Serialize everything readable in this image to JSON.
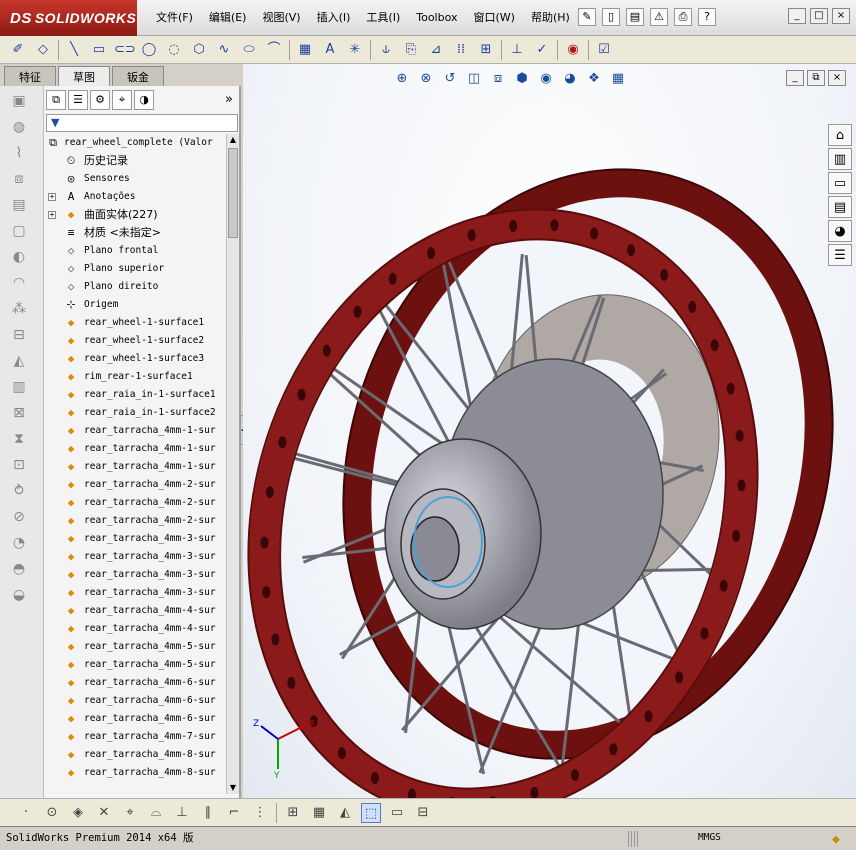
{
  "app": {
    "logo": "SOLIDWORKS",
    "logo_mark": "DS"
  },
  "menu": [
    "文件(F)",
    "编辑(E)",
    "视图(V)",
    "插入(I)",
    "工具(I)",
    "Toolbox",
    "窗口(W)",
    "帮助(H)"
  ],
  "window_controls": [
    "_",
    "□",
    "×"
  ],
  "left_tabs": [
    "特征",
    "草图",
    "钣金"
  ],
  "left_tab_active": 1,
  "tree": [
    {
      "label": "rear_wheel_complete  (Valor",
      "icon": "part-icon",
      "type": "root"
    },
    {
      "label": "历史记录",
      "icon": "history-icon",
      "cjk": true
    },
    {
      "label": "Sensores",
      "icon": "sensor-icon"
    },
    {
      "label": "Anotações",
      "icon": "annotation-icon",
      "expand": true
    },
    {
      "label": "曲面实体(227)",
      "icon": "surface-bodies-icon",
      "expand": true,
      "cjk": true
    },
    {
      "label": "材质 <未指定>",
      "icon": "material-icon",
      "cjk": true
    },
    {
      "label": "Plano frontal",
      "icon": "plane-icon"
    },
    {
      "label": "Plano superior",
      "icon": "plane-icon"
    },
    {
      "label": "Plano direito",
      "icon": "plane-icon"
    },
    {
      "label": "Origem",
      "icon": "origin-icon"
    },
    {
      "label": "rear_wheel-1-surface1",
      "icon": "surface-icon"
    },
    {
      "label": "rear_wheel-1-surface2",
      "icon": "surface-icon"
    },
    {
      "label": "rear_wheel-1-surface3",
      "icon": "surface-icon"
    },
    {
      "label": "rim_rear-1-surface1",
      "icon": "surface-icon"
    },
    {
      "label": "rear_raia_in-1-surface1",
      "icon": "surface-icon"
    },
    {
      "label": "rear_raia_in-1-surface2",
      "icon": "surface-icon"
    },
    {
      "label": "rear_tarracha_4mm-1-sur",
      "icon": "surface-icon"
    },
    {
      "label": "rear_tarracha_4mm-1-sur",
      "icon": "surface-icon"
    },
    {
      "label": "rear_tarracha_4mm-1-sur",
      "icon": "surface-icon"
    },
    {
      "label": "rear_tarracha_4mm-2-sur",
      "icon": "surface-icon"
    },
    {
      "label": "rear_tarracha_4mm-2-sur",
      "icon": "surface-icon"
    },
    {
      "label": "rear_tarracha_4mm-2-sur",
      "icon": "surface-icon"
    },
    {
      "label": "rear_tarracha_4mm-3-sur",
      "icon": "surface-icon"
    },
    {
      "label": "rear_tarracha_4mm-3-sur",
      "icon": "surface-icon"
    },
    {
      "label": "rear_tarracha_4mm-3-sur",
      "icon": "surface-icon"
    },
    {
      "label": "rear_tarracha_4mm-3-sur",
      "icon": "surface-icon"
    },
    {
      "label": "rear_tarracha_4mm-4-sur",
      "icon": "surface-icon"
    },
    {
      "label": "rear_tarracha_4mm-4-sur",
      "icon": "surface-icon"
    },
    {
      "label": "rear_tarracha_4mm-5-sur",
      "icon": "surface-icon"
    },
    {
      "label": "rear_tarracha_4mm-5-sur",
      "icon": "surface-icon"
    },
    {
      "label": "rear_tarracha_4mm-6-sur",
      "icon": "surface-icon"
    },
    {
      "label": "rear_tarracha_4mm-6-sur",
      "icon": "surface-icon"
    },
    {
      "label": "rear_tarracha_4mm-6-sur",
      "icon": "surface-icon"
    },
    {
      "label": "rear_tarracha_4mm-7-sur",
      "icon": "surface-icon"
    },
    {
      "label": "rear_tarracha_4mm-8-sur",
      "icon": "surface-icon"
    },
    {
      "label": "rear_tarracha_4mm-8-sur",
      "icon": "surface-icon"
    }
  ],
  "triad": {
    "x": "X",
    "y": "Y",
    "z": "Z"
  },
  "status": {
    "text": "SolidWorks Premium 2014 x64 版",
    "units": "MMGS"
  },
  "colors": {
    "rim": "#8b1a1a",
    "hub": "#a8a8ae",
    "accent": "#c8372d"
  }
}
